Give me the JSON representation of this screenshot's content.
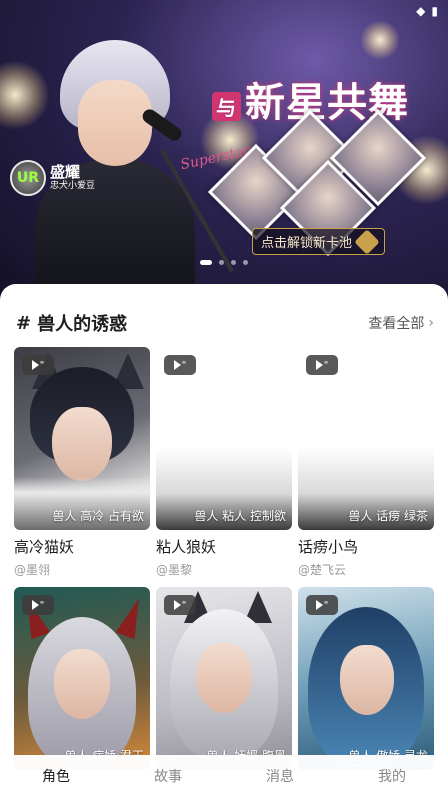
{
  "banner": {
    "title_prefix": "与",
    "title": "新星共舞",
    "script_text": "Superstar",
    "logo_badge": "UR",
    "logo_name": "盛耀",
    "logo_sub": "忠犬小爱豆",
    "unlock_label": "点击解锁新卡池",
    "page_count": 4,
    "active_page": 0
  },
  "section": {
    "title": "兽人的诱惑",
    "see_all": "查看全部"
  },
  "cards": [
    {
      "name": "高冷猫妖",
      "author": "@墨翎",
      "tags": "兽人 高冷 占有欲",
      "play_badge": "▶\""
    },
    {
      "name": "粘人狼妖",
      "author": "@墨黎",
      "tags": "兽人 粘人 控制欲",
      "play_badge": "▶\""
    },
    {
      "name": "话痨小鸟",
      "author": "@楚飞云",
      "tags": "兽人 话痨 绿茶",
      "play_badge": "▶\""
    },
    {
      "name": "",
      "author": "",
      "tags": "兽人 病娇 君王",
      "play_badge": "▶\""
    },
    {
      "name": "",
      "author": "",
      "tags": "兽人 妩媚 腹黑",
      "play_badge": "▶\""
    },
    {
      "name": "",
      "author": "",
      "tags": "兽人 傲娇 灵龙",
      "play_badge": "▶\""
    }
  ],
  "tabs": [
    {
      "label": "角色",
      "active": true
    },
    {
      "label": "故事",
      "active": false
    },
    {
      "label": "消息",
      "active": false
    },
    {
      "label": "我的",
      "active": false
    }
  ],
  "colors": {
    "accent": "#d4356e",
    "gold": "#c9a14a"
  }
}
